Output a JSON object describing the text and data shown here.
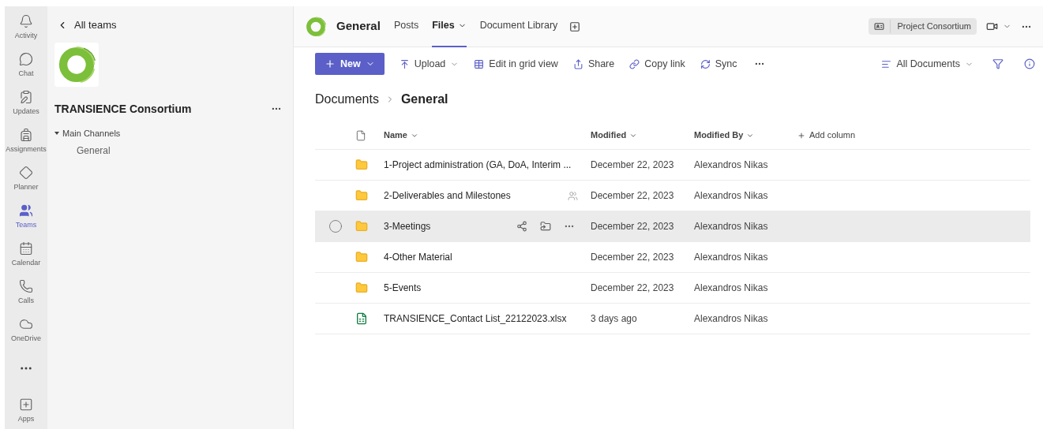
{
  "rail": [
    {
      "label": "Activity",
      "selected": false
    },
    {
      "label": "Chat",
      "selected": false
    },
    {
      "label": "Updates",
      "selected": false
    },
    {
      "label": "Assignments",
      "selected": false
    },
    {
      "label": "Planner",
      "selected": false
    },
    {
      "label": "Teams",
      "selected": true
    },
    {
      "label": "Calendar",
      "selected": false
    },
    {
      "label": "Calls",
      "selected": false
    },
    {
      "label": "OneDrive",
      "selected": false
    }
  ],
  "rail_bottom": {
    "label": "Apps"
  },
  "team_panel": {
    "back_label": "All teams",
    "team_name": "TRANSIENCE Consortium",
    "section": {
      "label": "Main Channels",
      "expanded": true,
      "channels": [
        {
          "label": "General",
          "selected": false
        }
      ]
    }
  },
  "header": {
    "channel": "General",
    "tabs": [
      {
        "label": "Posts",
        "selected": false,
        "dropdown": false
      },
      {
        "label": "Files",
        "selected": true,
        "dropdown": true
      },
      {
        "label": "Document Library",
        "selected": false,
        "dropdown": false
      }
    ],
    "badge": "Project Consortium"
  },
  "toolbar": {
    "new": "New",
    "actions": [
      {
        "label": "Upload",
        "dropdown": true
      },
      {
        "label": "Edit in grid view",
        "dropdown": false
      },
      {
        "label": "Share",
        "dropdown": false
      },
      {
        "label": "Copy link",
        "dropdown": false
      },
      {
        "label": "Sync",
        "dropdown": false
      }
    ],
    "view": "All Documents"
  },
  "breadcrumb": [
    "Documents",
    "General"
  ],
  "table": {
    "columns": [
      "Name",
      "Modified",
      "Modified By"
    ],
    "add_column": "Add column",
    "rows": [
      {
        "kind": "folder",
        "name": "1-Project administration (GA, DoA, Interim ...",
        "modified": "December 22, 2023",
        "modified_by": "Alexandros Nikas",
        "shared": false,
        "hovered": false
      },
      {
        "kind": "folder",
        "name": "2-Deliverables and Milestones",
        "modified": "December 22, 2023",
        "modified_by": "Alexandros Nikas",
        "shared": true,
        "hovered": false
      },
      {
        "kind": "folder",
        "name": "3-Meetings",
        "modified": "December 22, 2023",
        "modified_by": "Alexandros Nikas",
        "shared": false,
        "hovered": true
      },
      {
        "kind": "folder",
        "name": "4-Other Material",
        "modified": "December 22, 2023",
        "modified_by": "Alexandros Nikas",
        "shared": false,
        "hovered": false
      },
      {
        "kind": "folder",
        "name": "5-Events",
        "modified": "December 22, 2023",
        "modified_by": "Alexandros Nikas",
        "shared": false,
        "hovered": false
      },
      {
        "kind": "spreadsheet",
        "name": "TRANSIENCE_Contact List_22122023.xlsx",
        "modified": "3 days ago",
        "modified_by": "Alexandros Nikas",
        "shared": false,
        "hovered": false
      }
    ]
  }
}
